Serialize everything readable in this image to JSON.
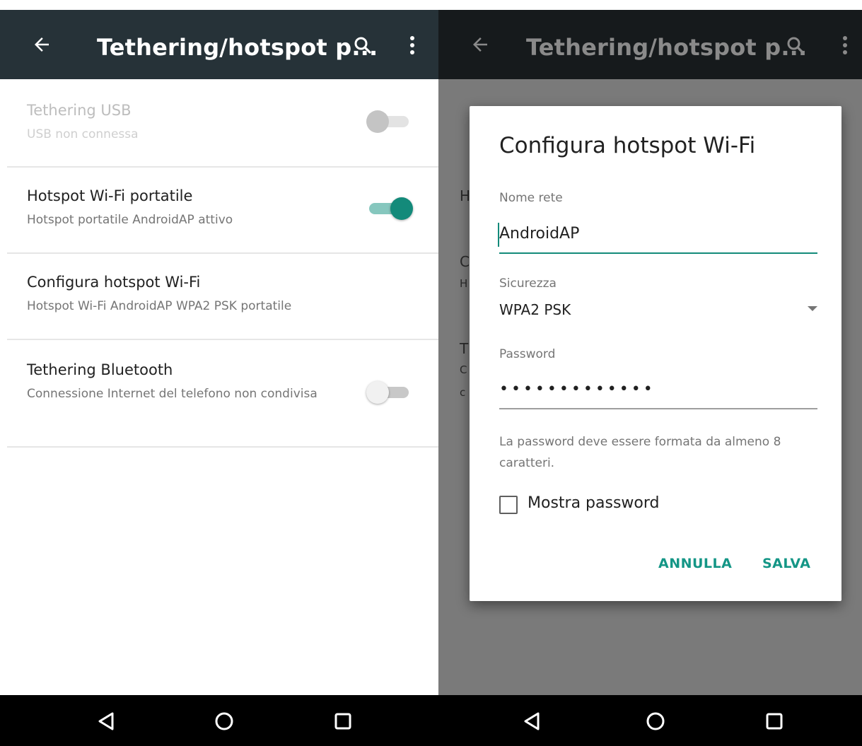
{
  "left": {
    "title": "Tethering/hotspot p...",
    "settings": [
      {
        "title": "Tethering USB",
        "summary": "USB non connessa",
        "switch": "off",
        "enabled": false
      },
      {
        "title": "Hotspot Wi-Fi portatile",
        "summary": "Hotspot portatile AndroidAP attivo",
        "switch": "on",
        "enabled": true
      },
      {
        "title": "Configura hotspot Wi-Fi",
        "summary": "Hotspot Wi-Fi AndroidAP WPA2 PSK portatile"
      },
      {
        "title": "Tethering Bluetooth",
        "summary": "Connessione Internet del telefono non condivisa",
        "switch": "off",
        "enabled": true
      }
    ]
  },
  "right": {
    "title": "Tethering/hotspot p...",
    "peek": [
      "H",
      "C",
      "H",
      "T",
      "C",
      "c"
    ],
    "dialog": {
      "title": "Configura hotspot Wi-Fi",
      "network_label": "Nome rete",
      "network_value": "AndroidAP",
      "security_label": "Sicurezza",
      "security_value": "WPA2 PSK",
      "password_label": "Password",
      "password_value": "•••••••••••••",
      "hint": "La password deve essere formata da almeno 8 caratteri.",
      "show_password_label": "Mostra password",
      "show_password_checked": false,
      "cancel": "ANNULLA",
      "save": "SALVA"
    }
  },
  "icons": {
    "back": "arrow-back-icon",
    "search": "search-icon",
    "more": "more-vert-icon",
    "nav_back": "nav-back-triangle-icon",
    "nav_home": "nav-home-circle-icon",
    "nav_recents": "nav-recents-square-icon"
  },
  "colors": {
    "appbar": "#263238",
    "accent": "#138a7a",
    "scrim": "#7a7a7a"
  }
}
